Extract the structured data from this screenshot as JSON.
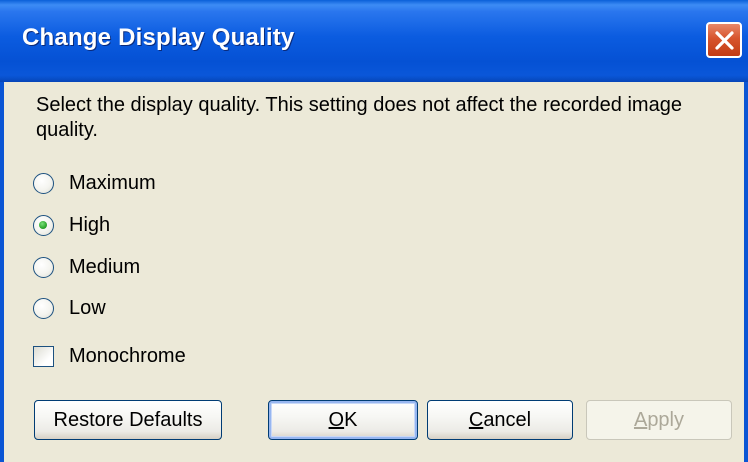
{
  "window": {
    "title": "Change Display Quality",
    "close_icon": "close-icon"
  },
  "description": "Select the display quality.  This setting does not affect the recorded image quality.",
  "quality_options": [
    {
      "label": "Maximum",
      "selected": false
    },
    {
      "label": "High",
      "selected": true
    },
    {
      "label": "Medium",
      "selected": false
    },
    {
      "label": "Low",
      "selected": false
    }
  ],
  "monochrome": {
    "label": "Monochrome",
    "checked": false
  },
  "buttons": {
    "restore_defaults": "Restore Defaults",
    "ok": {
      "accel": "O",
      "rest": "K"
    },
    "cancel": {
      "accel": "C",
      "rest": "ancel"
    },
    "apply": {
      "accel": "A",
      "rest": "pply",
      "enabled": false
    }
  },
  "colors": {
    "titlebar": "#0b5ce0",
    "dialog_bg": "#ece9d8",
    "close_button": "#d7542d",
    "radio_selected": "#2fa82f"
  }
}
